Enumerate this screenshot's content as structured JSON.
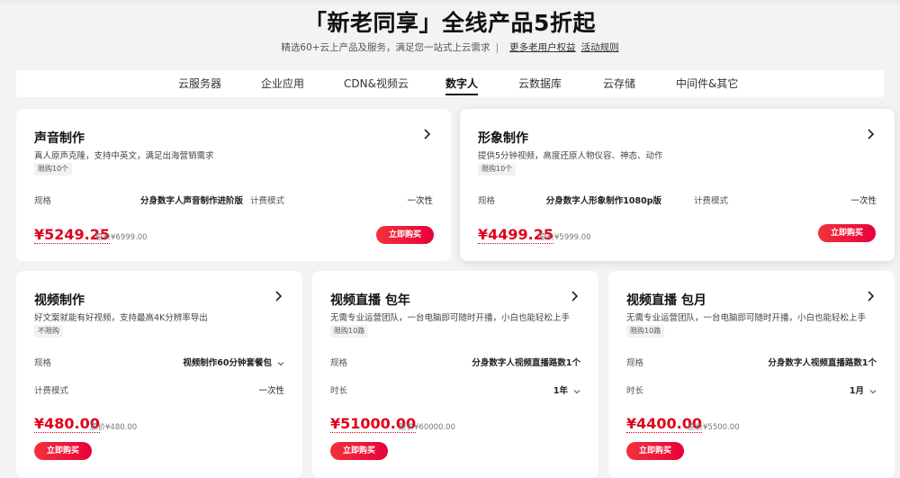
{
  "header": {
    "title": "「新老同享」全线产品5折起",
    "subtitle": "精选60+云上产品及服务，满足您一站式上云需求",
    "separator": "|",
    "link_benefits": "更多老用户权益",
    "link_rules": "活动规则"
  },
  "tabs": [
    {
      "label": "云服务器"
    },
    {
      "label": "企业应用"
    },
    {
      "label": "CDN&视频云"
    },
    {
      "label": "数字人"
    },
    {
      "label": "云数据库"
    },
    {
      "label": "云存储"
    },
    {
      "label": "中间件&其它"
    }
  ],
  "active_tab": "数字人",
  "buy_label": "立即购买",
  "accent_color": "#e0001b",
  "cards": [
    {
      "title": "声音制作",
      "desc": "真人原声克隆，支持中英文，满足出海营销需求",
      "tag": "限购10个",
      "spec_label": "规格",
      "spec_value": "分身数字人声音制作进阶版",
      "mode_label": "计费模式",
      "mode_value": "一次性",
      "price": "¥5249.25",
      "orig": "原价¥6999.00"
    },
    {
      "title": "形象制作",
      "desc": "提供5分钟视频，高度还原人物仪容、神态、动作",
      "tag": "限购10个",
      "spec_label": "规格",
      "spec_value": "分身数字人形象制作1080p版",
      "mode_label": "计费模式",
      "mode_value": "一次性",
      "price": "¥4499.25",
      "orig": "原价¥5999.00"
    },
    {
      "title": "视频制作",
      "desc": "好文案就能有好视频，支持最高4K分辨率导出",
      "tag": "不限购",
      "spec_label": "规格",
      "spec_value": "视频制作60分钟套餐包",
      "mode_label": "计费模式",
      "mode_value": "一次性",
      "price": "¥480.00",
      "orig": "原价¥480.00"
    },
    {
      "title": "视频直播 包年",
      "desc": "无需专业运营团队，一台电脑即可随时开播，小白也能轻松上手",
      "tag": "限购10路",
      "spec_label": "规格",
      "spec_value": "分身数字人视频直播路数1个",
      "mode_label": "时长",
      "mode_value": "1年",
      "price": "¥51000.00",
      "orig": "原价¥60000.00"
    },
    {
      "title": "视频直播 包月",
      "desc": "无需专业运营团队，一台电脑即可随时开播，小白也能轻松上手",
      "tag": "限购10路",
      "spec_label": "规格",
      "spec_value": "分身数字人视频直播路数1个",
      "mode_label": "时长",
      "mode_value": "1月",
      "price": "¥4400.00",
      "orig": "原价¥5500.00"
    }
  ]
}
